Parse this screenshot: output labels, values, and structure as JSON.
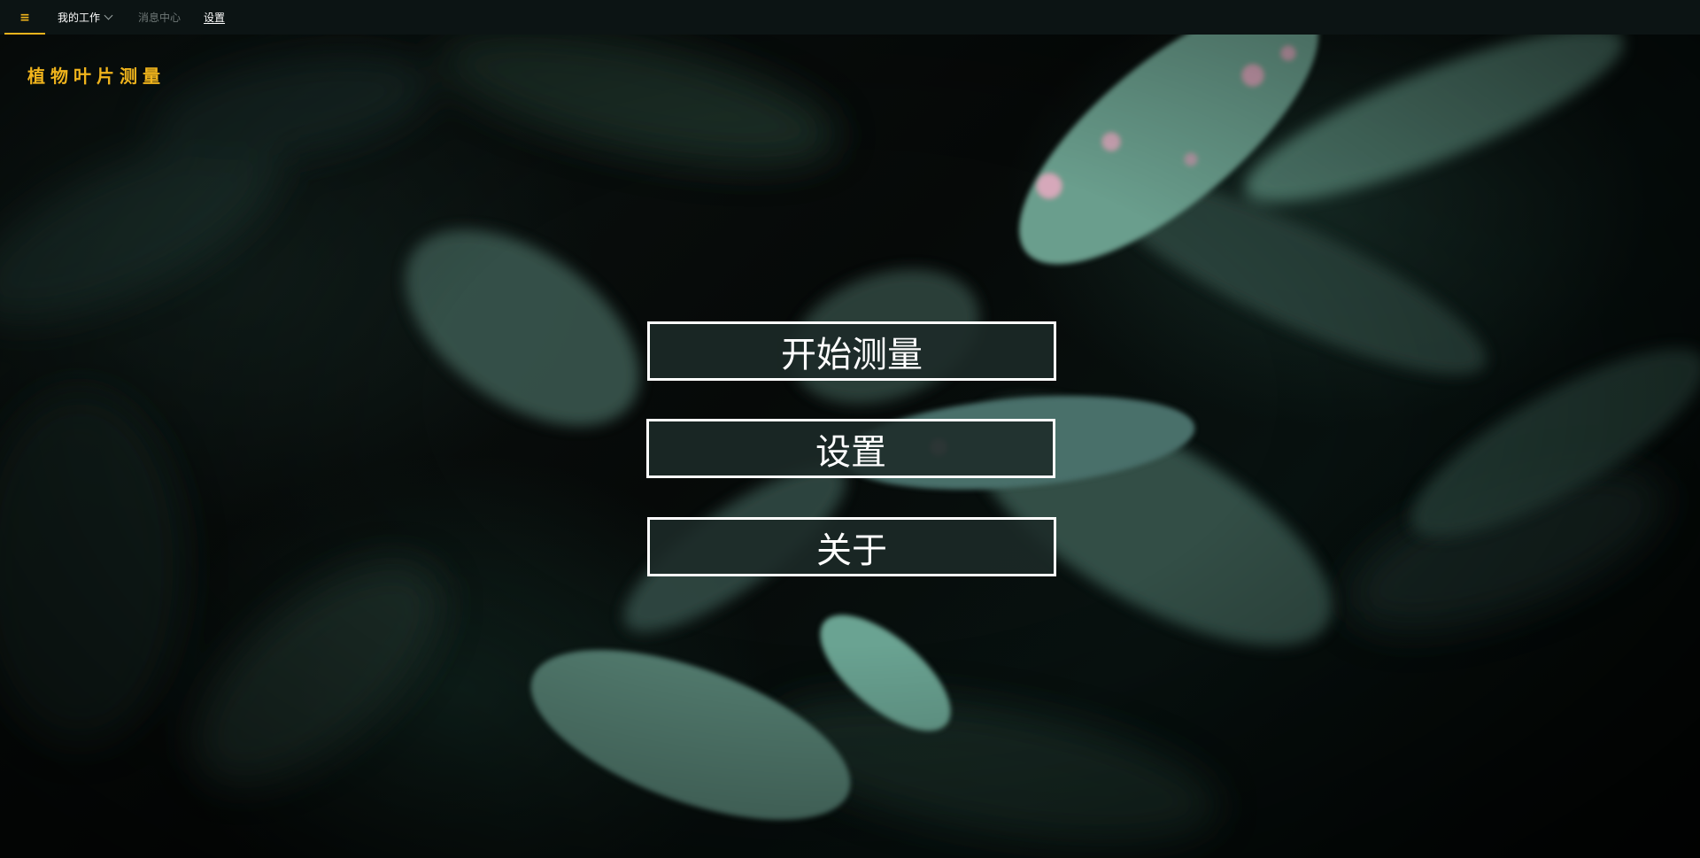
{
  "topbar": {
    "menu_icon": "≡",
    "items": [
      {
        "label": "我的工作",
        "has_dropdown": true
      },
      {
        "label": "消息中心",
        "disabled": true
      },
      {
        "label": "设置",
        "underlined": true
      }
    ]
  },
  "app": {
    "title": "植物叶片测量"
  },
  "menu": {
    "start_label": "开始测量",
    "settings_label": "设置",
    "about_label": "关于"
  },
  "colors": {
    "accent": "#f0b41c",
    "topbar_bg": "#0c1414",
    "button_border": "#ffffff",
    "button_bg": "#1c2a28"
  }
}
